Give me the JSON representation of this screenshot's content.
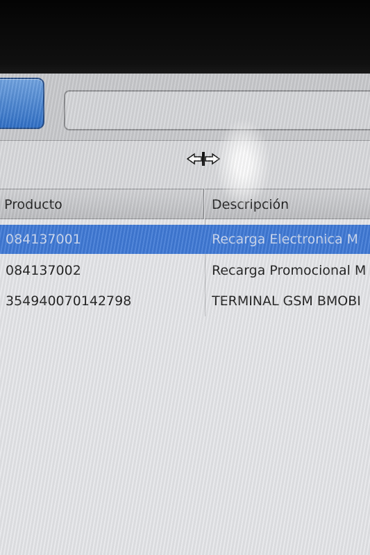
{
  "table": {
    "columns": [
      "Producto",
      "Descripción"
    ],
    "rows": [
      {
        "producto": "084137001",
        "descripcion": "Recarga Electronica  M",
        "selected": true
      },
      {
        "producto": "084137002",
        "descripcion": "Recarga Promocional M",
        "selected": false
      },
      {
        "producto": "354940070142798",
        "descripcion": "TERMINAL GSM BMOBI",
        "selected": false
      }
    ]
  },
  "colors": {
    "selection": "#3f79d6",
    "button": "#3a78cf",
    "header": "#c4c5c8"
  },
  "icons": {
    "cursor": "column-resize-cursor-icon"
  }
}
